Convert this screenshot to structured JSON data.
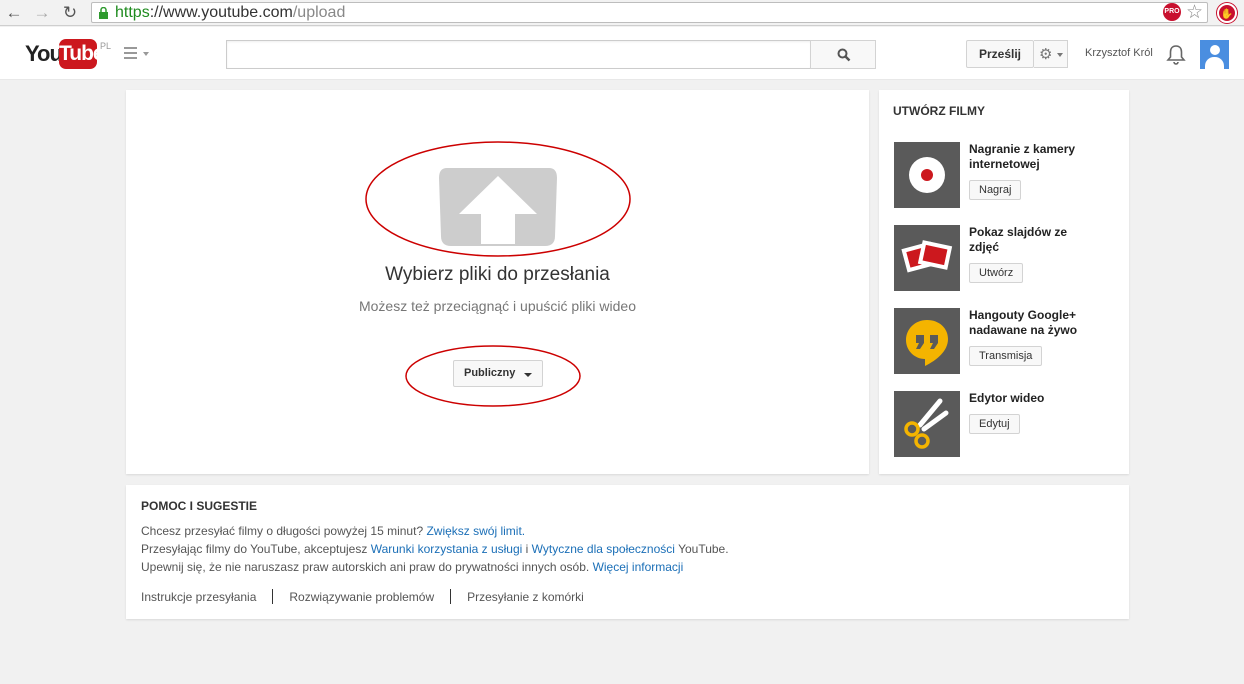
{
  "browser": {
    "url_scheme": "https",
    "url_host": "://www.youtube.com",
    "url_path": "/upload",
    "ext_label": "PRO"
  },
  "header": {
    "logo_you": "You",
    "logo_tube": "Tube",
    "logo_region": "PL",
    "search_value": "",
    "upload_label": "Prześlij",
    "username": "Krzysztof Król"
  },
  "upload": {
    "title": "Wybierz pliki do przesłania",
    "subtitle": "Możesz też przeciągnąć i upuścić pliki wideo",
    "privacy_label": "Publiczny"
  },
  "create": {
    "title": "UTWÓRZ FILMY",
    "tools": [
      {
        "name": "Nagranie z kamery internetowej",
        "button": "Nagraj",
        "icon": "webcam-record-icon"
      },
      {
        "name": "Pokaz slajdów ze zdjęć",
        "button": "Utwórz",
        "icon": "photo-slideshow-icon"
      },
      {
        "name": "Hangouty Google+ nadawane na żywo",
        "button": "Transmisja",
        "icon": "hangouts-icon"
      },
      {
        "name": "Edytor wideo",
        "button": "Edytuj",
        "icon": "scissors-icon"
      }
    ]
  },
  "help": {
    "title": "POMOC I SUGESTIE",
    "line1_text": "Chcesz przesyłać filmy o długości powyżej 15 minut? ",
    "line1_link": "Zwiększ swój limit.",
    "line2_a": "Przesyłając filmy do YouTube, akceptujesz ",
    "line2_link1": "Warunki korzystania z usługi",
    "line2_b": " i ",
    "line2_link2": "Wytyczne dla społeczności",
    "line2_c": " YouTube.",
    "line3_text": "Upewnij się, że nie naruszasz praw autorskich ani praw do prywatności innych osób. ",
    "line3_link": "Więcej informacji",
    "links": [
      "Instrukcje przesyłania",
      "Rozwiązywanie problemów",
      "Przesyłanie z komórki"
    ]
  },
  "colors": {
    "annotation_ring": "#cc0000",
    "brand_red": "#cc181e",
    "link_blue": "#1b6fb7"
  }
}
